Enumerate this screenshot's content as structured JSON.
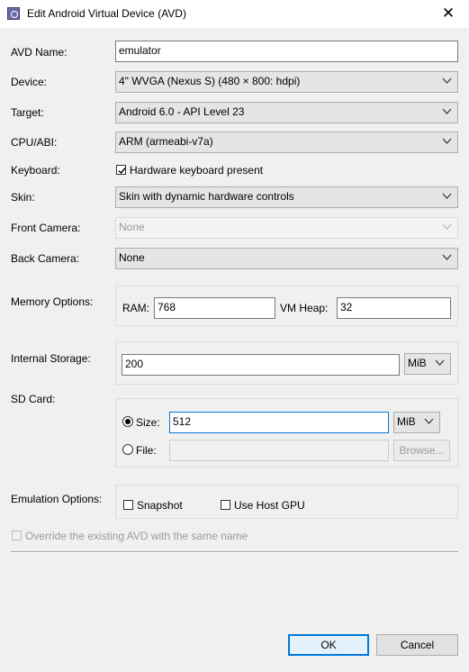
{
  "window": {
    "title": "Edit Android Virtual Device (AVD)",
    "close_glyph": "✕"
  },
  "form": {
    "avd_name": {
      "label": "AVD Name:",
      "value": "emulator"
    },
    "device": {
      "label": "Device:",
      "value": "4\" WVGA (Nexus S) (480 × 800: hdpi)"
    },
    "target": {
      "label": "Target:",
      "value": "Android 6.0 - API Level 23"
    },
    "cpu_abi": {
      "label": "CPU/ABI:",
      "value": "ARM (armeabi-v7a)"
    },
    "keyboard": {
      "label": "Keyboard:",
      "checkbox_label": "Hardware keyboard present",
      "checked": true
    },
    "skin": {
      "label": "Skin:",
      "value": "Skin with dynamic hardware controls"
    },
    "front_camera": {
      "label": "Front Camera:",
      "value": "None"
    },
    "back_camera": {
      "label": "Back Camera:",
      "value": "None"
    },
    "memory": {
      "label": "Memory Options:",
      "ram_label": "RAM:",
      "ram_value": "768",
      "heap_label": "VM Heap:",
      "heap_value": "32"
    },
    "internal_storage": {
      "label": "Internal Storage:",
      "value": "200",
      "unit": "MiB"
    },
    "sd_card": {
      "label": "SD Card:",
      "size_label": "Size:",
      "size_value": "512",
      "size_unit": "MiB",
      "file_label": "File:",
      "file_value": "",
      "browse_label": "Browse...",
      "selected": "size"
    },
    "emulation": {
      "label": "Emulation Options:",
      "snapshot_label": "Snapshot",
      "snapshot_checked": false,
      "gpu_label": "Use Host GPU",
      "gpu_checked": false
    },
    "override": {
      "label": "Override the existing AVD with the same name",
      "checked": false
    }
  },
  "buttons": {
    "ok": "OK",
    "cancel": "Cancel"
  },
  "colors": {
    "accent": "#0078d7",
    "background": "#f0f0f0",
    "disabled_text": "#9a9a9a"
  }
}
